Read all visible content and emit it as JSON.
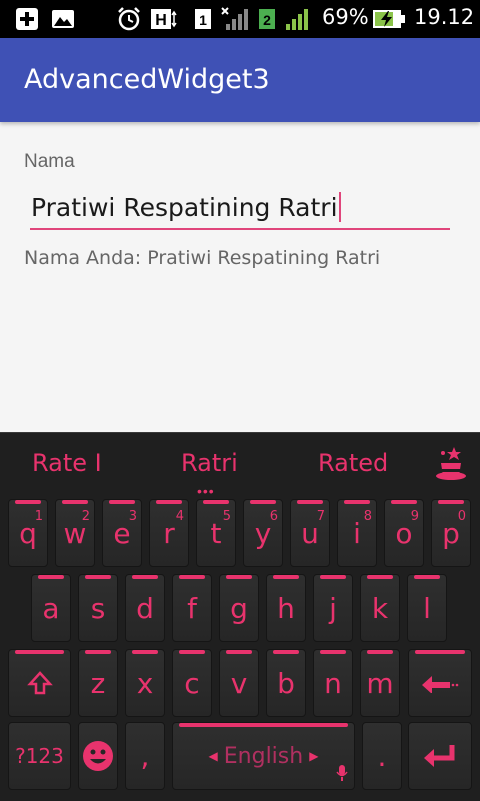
{
  "status_bar": {
    "battery": "69%",
    "time": "19.12",
    "icons": [
      "add-icon",
      "image-icon",
      "alarm-icon",
      "h-network-icon",
      "sim1-icon",
      "signal-muted-icon",
      "sim2-icon",
      "signal-icon",
      "battery-charging-icon"
    ]
  },
  "app": {
    "title": "AdvancedWidget3"
  },
  "form": {
    "label": "Nama",
    "input_value": "Pratiwi Respatining Ratri",
    "output": "Nama Anda: Pratiwi Respatining Ratri"
  },
  "keyboard": {
    "suggestions": [
      "Rate I",
      "Ratri",
      "Rated"
    ],
    "suggestion_dots": "•••",
    "row1": [
      {
        "k": "q",
        "n": "1"
      },
      {
        "k": "w",
        "n": "2"
      },
      {
        "k": "e",
        "n": "3"
      },
      {
        "k": "r",
        "n": "4"
      },
      {
        "k": "t",
        "n": "5"
      },
      {
        "k": "y",
        "n": "6"
      },
      {
        "k": "u",
        "n": "7"
      },
      {
        "k": "i",
        "n": "8"
      },
      {
        "k": "o",
        "n": "9"
      },
      {
        "k": "p",
        "n": "0"
      }
    ],
    "row2": [
      "a",
      "s",
      "d",
      "f",
      "g",
      "h",
      "j",
      "k",
      "l"
    ],
    "row3": [
      "z",
      "x",
      "c",
      "v",
      "b",
      "n",
      "m"
    ],
    "symbols_label": "?123",
    "comma": ",",
    "space_label": "English",
    "period": ".",
    "accent_color": "#e8336d"
  }
}
